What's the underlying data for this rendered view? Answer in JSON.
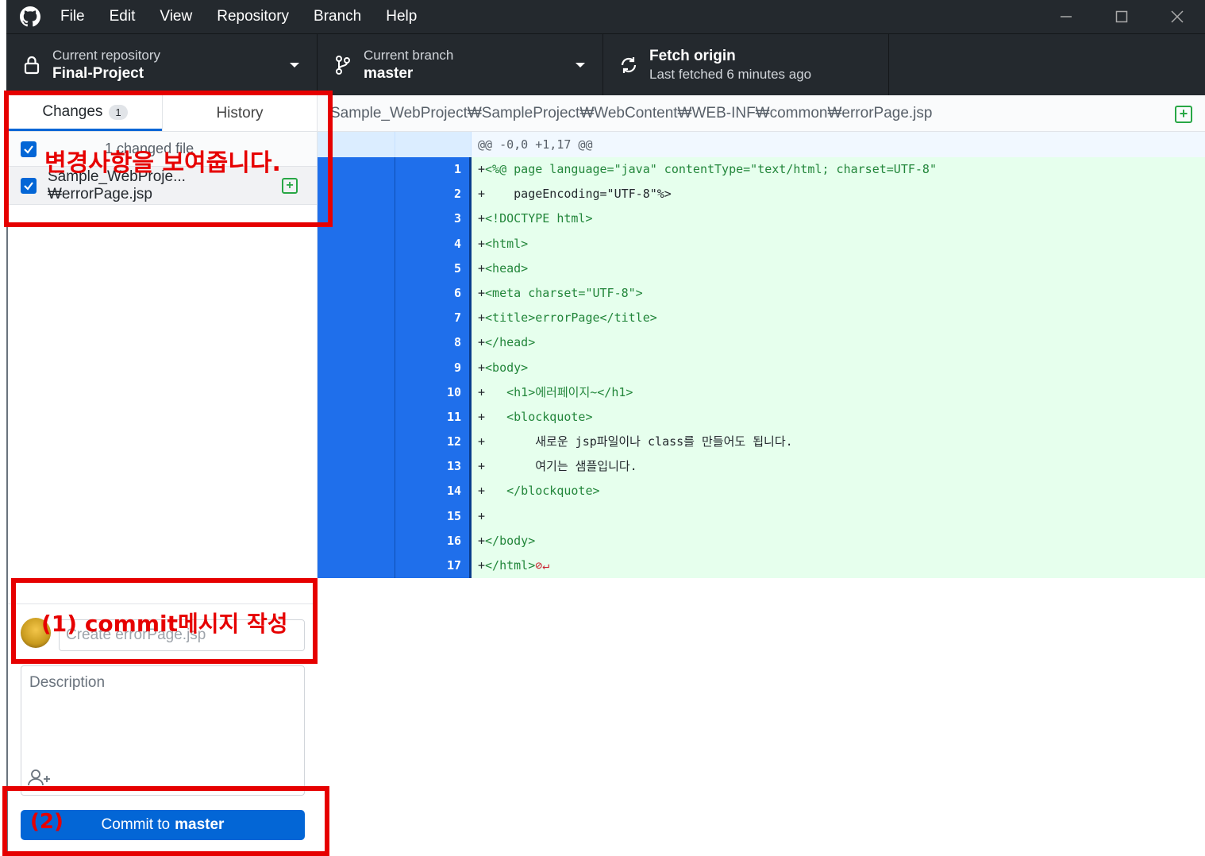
{
  "menu": {
    "items": [
      "File",
      "Edit",
      "View",
      "Repository",
      "Branch",
      "Help"
    ]
  },
  "toolbar": {
    "repo_label": "Current repository",
    "repo_value": "Final-Project",
    "branch_label": "Current branch",
    "branch_value": "master",
    "fetch_label": "Fetch origin",
    "fetch_sub": "Last fetched 6 minutes ago"
  },
  "sidebar": {
    "tab_changes": "Changes",
    "tab_changes_count": "1",
    "tab_history": "History",
    "changed_files_header": "1 changed file",
    "file_name": "Sample_WebProje...₩errorPage.jsp",
    "summary_placeholder": "Create errorPage.jsp",
    "description_placeholder": "Description",
    "commit_prefix": "Commit to",
    "commit_branch": "master"
  },
  "diff": {
    "path": "Sample_WebProject₩SampleProject₩WebContent₩WEB-INF₩common₩errorPage.jsp",
    "hunk": "@@ -0,0 +1,17 @@",
    "lines": [
      {
        "num": "1",
        "prefix": "+",
        "text": "<%@ page language=\"java\" contentType=\"text/html; charset=UTF-8\""
      },
      {
        "num": "2",
        "prefix": "+",
        "text": "    pageEncoding=\"UTF-8\"%>"
      },
      {
        "num": "3",
        "prefix": "+",
        "text": "<!DOCTYPE html>"
      },
      {
        "num": "4",
        "prefix": "+",
        "text": "<html>"
      },
      {
        "num": "5",
        "prefix": "+",
        "text": "<head>"
      },
      {
        "num": "6",
        "prefix": "+",
        "text": "<meta charset=\"UTF-8\">"
      },
      {
        "num": "7",
        "prefix": "+",
        "text": "<title>errorPage</title>"
      },
      {
        "num": "8",
        "prefix": "+",
        "text": "</head>"
      },
      {
        "num": "9",
        "prefix": "+",
        "text": "<body>"
      },
      {
        "num": "10",
        "prefix": "+",
        "text": "   <h1>에러페이지~</h1>"
      },
      {
        "num": "11",
        "prefix": "+",
        "text": "   <blockquote>"
      },
      {
        "num": "12",
        "prefix": "+",
        "text": "       새로운 jsp파일이나 class를 만들어도 됩니다."
      },
      {
        "num": "13",
        "prefix": "+",
        "text": "       여기는 샘플입니다."
      },
      {
        "num": "14",
        "prefix": "+",
        "text": "   </blockquote>"
      },
      {
        "num": "15",
        "prefix": "+",
        "text": ""
      },
      {
        "num": "16",
        "prefix": "+",
        "text": "</body>"
      },
      {
        "num": "17",
        "prefix": "+",
        "text": "</html>"
      }
    ],
    "no_newline_marker": "⊘↵"
  },
  "annotations": {
    "changes_note": "변경사항을 보여줍니다.",
    "commit_msg_note": "(1) commit메시지 작성",
    "commit_btn_note": "(2)"
  },
  "colors": {
    "titlebar": "#24292e",
    "accent": "#0366d6",
    "added_bg": "#e6ffed",
    "annotation": "#e60000"
  }
}
